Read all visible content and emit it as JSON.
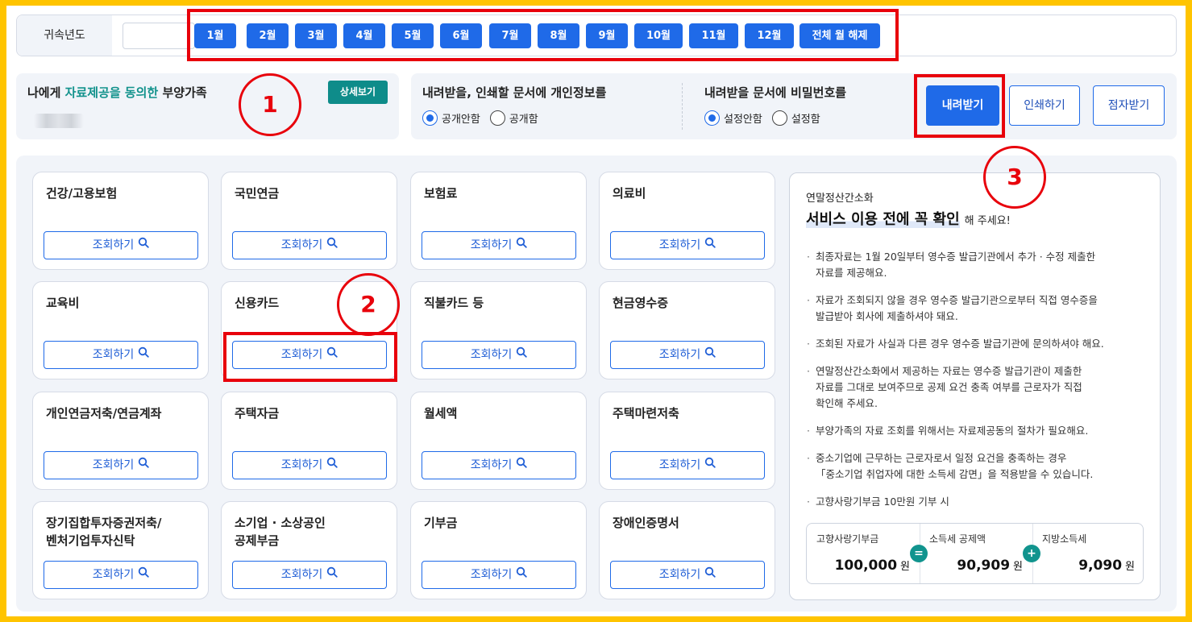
{
  "year_bar": {
    "label": "귀속년도",
    "selected_year": "",
    "months": [
      "1월",
      "2월",
      "3월",
      "4월",
      "5월",
      "6월",
      "7월",
      "8월",
      "9월",
      "10월",
      "11월",
      "12월",
      "전체 월 해제"
    ]
  },
  "dependents": {
    "title_pre": "나에게 ",
    "title_highlight": "자료제공을 동의한",
    "title_post": " 부양가족",
    "detail_button": "상세보기"
  },
  "options": {
    "personal_info": {
      "title": "내려받을, 인쇄할 문서에 개인정보를",
      "options": [
        "공개안함",
        "공개함"
      ],
      "selected": 0
    },
    "password": {
      "title": "내려받을 문서에 비밀번호를",
      "options": [
        "설정안함",
        "설정함"
      ],
      "selected": 0
    },
    "download_button": "내려받기",
    "print_button": "인쇄하기",
    "braille_button": "점자받기"
  },
  "annotations": [
    "1",
    "2",
    "3"
  ],
  "query_label": "조회하기",
  "categories": [
    [
      "건강/고용보험"
    ],
    [
      "국민연금"
    ],
    [
      "보험료"
    ],
    [
      "의료비"
    ],
    [
      "교육비"
    ],
    [
      "신용카드"
    ],
    [
      "직불카드 등"
    ],
    [
      "현금영수증"
    ],
    [
      "개인연금저축/연금계좌"
    ],
    [
      "주택자금"
    ],
    [
      "월세액"
    ],
    [
      "주택마련저축"
    ],
    [
      "장기집합투자증권저축/",
      "벤처기업투자신탁"
    ],
    [
      "소기업 · 소상공인",
      "공제부금"
    ],
    [
      "기부금"
    ],
    [
      "장애인증명서"
    ]
  ],
  "info": {
    "subtitle": "연말정산간소화",
    "headline": "서비스 이용 전에 꼭 확인",
    "headline_suffix": "해 주세요!",
    "notes": [
      [
        "최종자료는 1월 20일부터 영수증 발급기관에서 추가 · 수정 제출한",
        "자료를 제공해요."
      ],
      [
        "자료가 조회되지 않을 경우 영수증 발급기관으로부터 직접 영수증을",
        "발급받아 회사에 제출하셔야 돼요."
      ],
      [
        "조회된 자료가 사실과 다른 경우 영수증 발급기관에 문의하셔야 해요."
      ],
      [
        "연말정산간소화에서 제공하는 자료는 영수증 발급기관이 제출한",
        "자료를 그대로 보여주므로 공제 요건 충족 여부를 근로자가 직접",
        "확인해 주세요."
      ],
      [
        "부양가족의 자료 조회를 위해서는 자료제공동의 절차가 필요해요."
      ],
      [
        "중소기업에 근무하는 근로자로서 일정 요건을 충족하는 경우",
        "「중소기업 취업자에 대한 소득세 감면」을 적용받을 수 있습니다."
      ],
      [
        "고향사랑기부금 10만원 기부 시"
      ]
    ],
    "calc": [
      {
        "label": "고향사랑기부금",
        "value": "100,000",
        "unit": "원"
      },
      {
        "label": "소득세 공제액",
        "value": "90,909",
        "unit": "원"
      },
      {
        "label": "지방소득세",
        "value": "9,090",
        "unit": "원"
      }
    ],
    "calc_ops": [
      "=",
      "+"
    ]
  },
  "colors": {
    "primary": "#1f6ae8",
    "teal": "#0e8c8a",
    "highlight_red": "#e8000b",
    "border_yellow": "#ffc400"
  }
}
